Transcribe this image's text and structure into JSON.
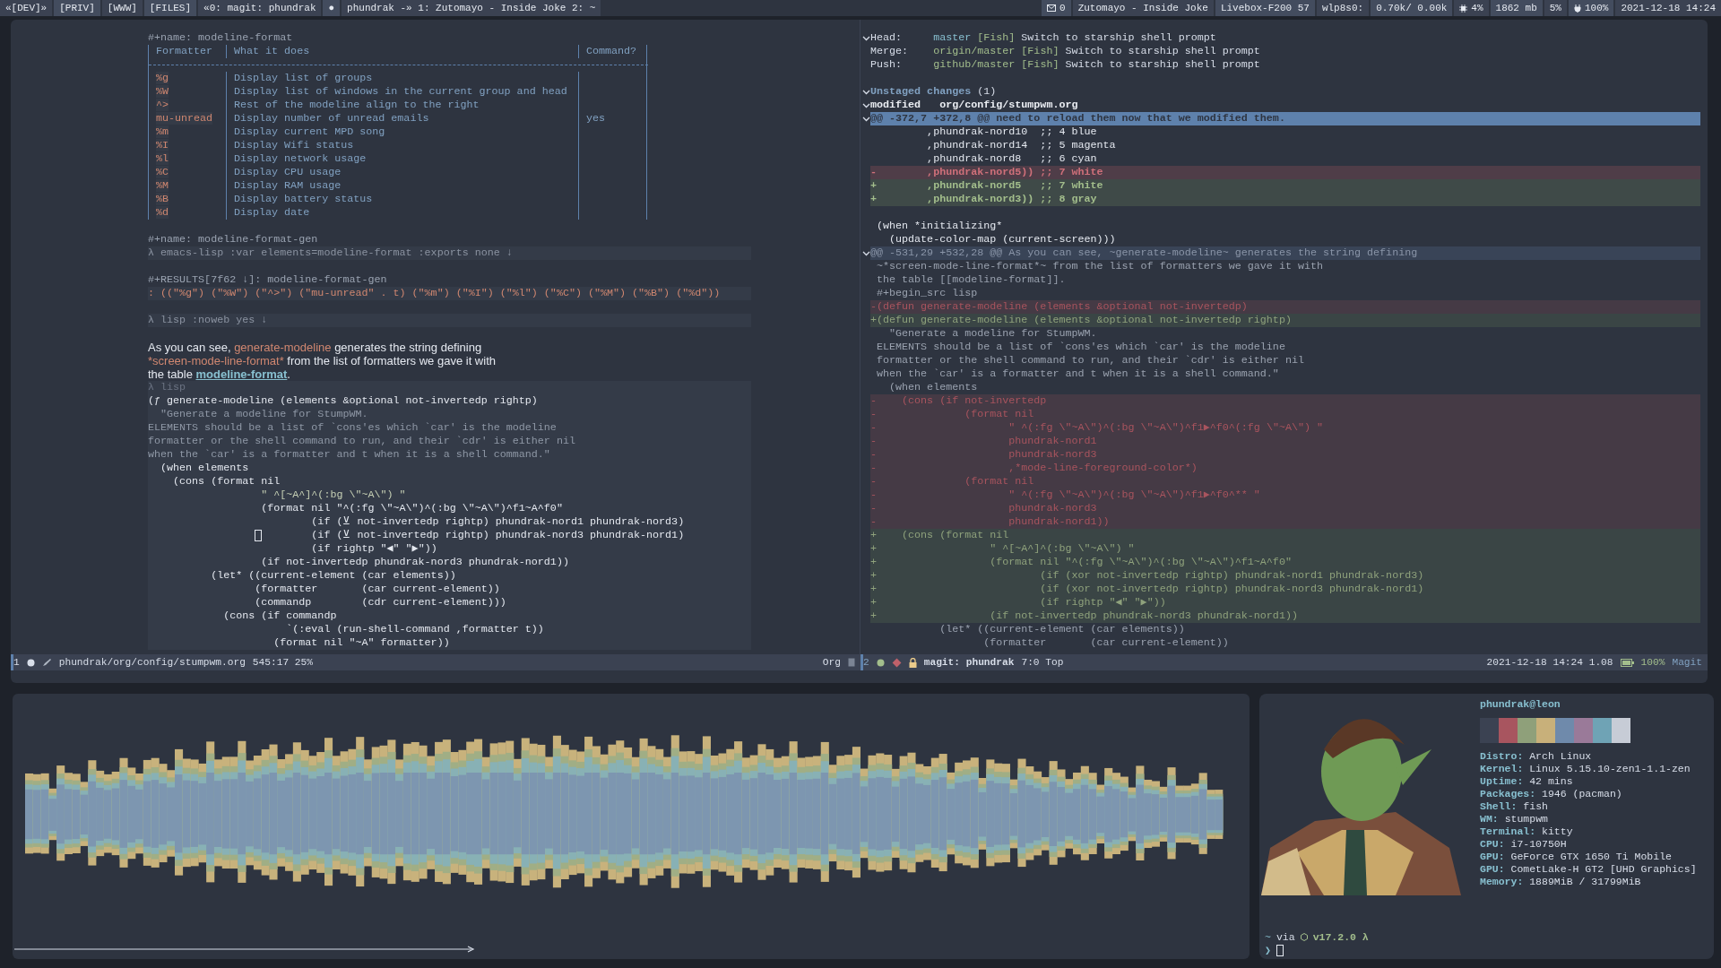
{
  "top_bar": {
    "left": [
      "«[DEV]»",
      "[PRIV]",
      "[WWW]",
      "[FILES]",
      "«0: magit: phundrak",
      "●",
      "phundrak -» 1: Zutomayo - Inside Joke 2: ~"
    ],
    "right": [
      {
        "kind": "mail",
        "text": "0"
      },
      {
        "kind": "plain",
        "text": "Zutomayo - Inside Joke"
      },
      {
        "kind": "plain",
        "text": "Livebox-F200 57"
      },
      {
        "kind": "plain",
        "text": "wlp8s0:"
      },
      {
        "kind": "plain",
        "text": "0.70k/ 0.00k"
      },
      {
        "kind": "cpu",
        "text": "4%"
      },
      {
        "kind": "plain",
        "text": "1862 mb"
      },
      {
        "kind": "plain",
        "text": "5%"
      },
      {
        "kind": "power",
        "text": "100%"
      },
      {
        "kind": "plain",
        "text": "2021-12-18 14:24"
      }
    ]
  },
  "left_pane": [
    {
      "kind": "keyword",
      "text": "#+name: modeline-format"
    },
    {
      "kind": "table",
      "columns": [
        "Formatter",
        "What it does",
        "Command?"
      ],
      "rows": [
        [
          "%g",
          "Display list of groups",
          ""
        ],
        [
          "%W",
          "Display list of windows in the current group and head",
          ""
        ],
        [
          "^>",
          "Rest of the modeline align to the right",
          ""
        ],
        [
          "mu-unread",
          "Display number of unread emails",
          "yes"
        ],
        [
          "%m",
          "Display current MPD song",
          ""
        ],
        [
          "%I",
          "Display Wifi status",
          ""
        ],
        [
          "%l",
          "Display network usage",
          ""
        ],
        [
          "%C",
          "Display CPU usage",
          ""
        ],
        [
          "%M",
          "Display RAM usage",
          ""
        ],
        [
          "%B",
          "Display battery status",
          ""
        ],
        [
          "%d",
          "Display date",
          ""
        ]
      ]
    },
    {
      "kind": "spacer"
    },
    {
      "kind": "keyword",
      "text": "#+name: modeline-format-gen"
    },
    {
      "kind": "src-header",
      "text": "λ emacs-lisp :var elements=modeline-format :exports none ↓"
    },
    {
      "kind": "spacer"
    },
    {
      "kind": "keyword",
      "text": "#+RESULTS[7f62 ↓]: modeline-format-gen"
    },
    {
      "kind": "result",
      "text": ": ((\"%g\") (\"%W\") (\"^>\") (\"mu-unread\" . t) (\"%m\") (\"%I\") (\"%l\") (\"%C\") (\"%M\") (\"%B\") (\"%d\"))"
    },
    {
      "kind": "spacer"
    },
    {
      "kind": "src-header",
      "text": "λ lisp :noweb yes ↓"
    },
    {
      "kind": "spacer"
    },
    {
      "kind": "prose",
      "lines": [
        [
          {
            "kind": "plain",
            "text": "As you can see, "
          },
          {
            "kind": "code",
            "text": "generate-modeline"
          },
          {
            "kind": "plain",
            "text": " generates the string defining"
          }
        ],
        [
          {
            "kind": "code",
            "text": "*screen-mode-line-format*"
          },
          {
            "kind": "plain",
            "text": " from the list of formatters we gave it with"
          }
        ],
        [
          {
            "kind": "plain",
            "text": "the table "
          },
          {
            "kind": "link",
            "text": "modeline-format"
          },
          {
            "kind": "plain",
            "text": "."
          }
        ]
      ]
    },
    {
      "kind": "src-block",
      "header": "λ lisp",
      "lines": [
        {
          "kind": "code",
          "text": "(ƒ generate-modeline (elements &optional not-invertedp rightp)"
        },
        {
          "kind": "doc",
          "text": "  \"Generate a modeline for StumpWM."
        },
        {
          "kind": "doc",
          "text": "ELEMENTS should be a list of `cons'es which `car' is the modeline"
        },
        {
          "kind": "doc",
          "text": "formatter or the shell command to run, and their `cdr' is either nil"
        },
        {
          "kind": "doc",
          "text": "when the `car' is a formatter and t when it is a shell command.\""
        },
        {
          "kind": "code",
          "text": "  (when elements"
        },
        {
          "kind": "code",
          "text": "    (cons (format nil"
        },
        {
          "kind": "string",
          "text": "                  \" ^[~A^]^(:bg \\\"~A\\\") \""
        },
        {
          "kind": "code",
          "text": "                  (format nil \"^(:fg \\\"~A\\\")^(:bg \\\"~A\\\")^f1~A^f0\""
        },
        {
          "kind": "code",
          "text": "                          (if (⊻ not-invertedp rightp) phundrak-nord1 phundrak-nord3)"
        },
        {
          "kind": "code",
          "text": "                          (if (⊻ not-invertedp rightp) phundrak-nord3 phundrak-nord1)",
          "cursor": true
        },
        {
          "kind": "code",
          "text": "                          (if rightp \"◀\" \"▶\"))"
        },
        {
          "kind": "code",
          "text": "                  (if not-invertedp phundrak-nord3 phundrak-nord1))"
        },
        {
          "kind": "code",
          "text": "          (let* ((current-element (car elements))"
        },
        {
          "kind": "code",
          "text": "                 (formatter       (car current-element))"
        },
        {
          "kind": "code",
          "text": "                 (commandp        (cdr current-element)))"
        },
        {
          "kind": "code",
          "text": "            (cons (if commandp"
        },
        {
          "kind": "code",
          "text": "                      `(:eval (run-shell-command ,formatter t))"
        },
        {
          "kind": "code",
          "text": "                    (format nil \"~A\" formatter))"
        }
      ]
    }
  ],
  "left_modeline": {
    "window": "1",
    "path": "phundrak/org/config/stumpwm.org",
    "position": "545:17 25%",
    "mode": "Org"
  },
  "right_pane": {
    "refs": [
      {
        "label": "Head:",
        "ref": "master",
        "tag": "[Fish]",
        "message": "Switch to starship shell prompt"
      },
      {
        "label": "Merge:",
        "ref": "origin/master",
        "tag": "[Fish]",
        "message": "Switch to starship shell prompt"
      },
      {
        "label": "Push:",
        "ref": "github/master",
        "tag": "[Fish]",
        "message": "Switch to starship shell prompt"
      }
    ],
    "section": {
      "title": "Unstaged changes",
      "count": "(1)"
    },
    "file": {
      "status": "modified",
      "path": "org/config/stumpwm.org"
    },
    "hunks": [
      {
        "header": "@@ -372,7 +372,8 @@ need to reload them now that we modified them.",
        "current": true,
        "lines": [
          {
            "kind": "context",
            "text": "         ,phundrak-nord10  ;; 4 blue"
          },
          {
            "kind": "context",
            "text": "         ,phundrak-nord14  ;; 5 magenta"
          },
          {
            "kind": "context",
            "text": "         ,phundrak-nord8   ;; 6 cyan"
          },
          {
            "kind": "removed",
            "text": "-        ,phundrak-nord5)) ;; 7 white"
          },
          {
            "kind": "added",
            "text": "+        ,phundrak-nord5   ;; 7 white"
          },
          {
            "kind": "added",
            "text": "+        ,phundrak-nord3)) ;; 8 gray"
          },
          {
            "kind": "spacer"
          },
          {
            "kind": "context",
            "text": " (when *initializing*"
          },
          {
            "kind": "context",
            "text": "   (update-color-map (current-screen)))"
          }
        ]
      },
      {
        "header": "@@ -531,29 +532,28 @@ As you can see, ~generate-modeline~ generates the string defining",
        "current": false,
        "lines": [
          {
            "kind": "context",
            "text": " ~*screen-mode-line-format*~ from the list of formatters we gave it with"
          },
          {
            "kind": "context",
            "text": " the table [[modeline-format]]."
          },
          {
            "kind": "context",
            "text": " #+begin_src lisp"
          },
          {
            "kind": "removed",
            "text": "-(defun generate-modeline (elements &optional not-invertedp)"
          },
          {
            "kind": "added",
            "text": "+(defun generate-modeline (elements &optional not-invertedp rightp)"
          },
          {
            "kind": "context",
            "text": "   \"Generate a modeline for StumpWM."
          },
          {
            "kind": "context",
            "text": " ELEMENTS should be a list of `cons'es which `car' is the modeline"
          },
          {
            "kind": "context",
            "text": " formatter or the shell command to run, and their `cdr' is either nil"
          },
          {
            "kind": "context",
            "text": " when the `car' is a formatter and t when it is a shell command.\""
          },
          {
            "kind": "context",
            "text": "   (when elements"
          },
          {
            "kind": "removed",
            "text": "-    (cons (if not-invertedp"
          },
          {
            "kind": "removed",
            "text": "-              (format nil"
          },
          {
            "kind": "removed",
            "text": "-                     \" ^(:fg \\\"~A\\\")^(:bg \\\"~A\\\")^f1▶^f0^(:fg \\\"~A\\\") \""
          },
          {
            "kind": "removed",
            "text": "-                     phundrak-nord1"
          },
          {
            "kind": "removed",
            "text": "-                     phundrak-nord3"
          },
          {
            "kind": "removed",
            "text": "-                     ,*mode-line-foreground-color*)"
          },
          {
            "kind": "removed",
            "text": "-              (format nil"
          },
          {
            "kind": "removed",
            "text": "-                     \" ^(:fg \\\"~A\\\")^(:bg \\\"~A\\\")^f1▶^f0^** \""
          },
          {
            "kind": "removed",
            "text": "-                     phundrak-nord3"
          },
          {
            "kind": "removed",
            "text": "-                     phundrak-nord1))"
          },
          {
            "kind": "added",
            "text": "+    (cons (format nil"
          },
          {
            "kind": "added",
            "text": "+                  \" ^[~A^]^(:bg \\\"~A\\\") \""
          },
          {
            "kind": "added",
            "text": "+                  (format nil \"^(:fg \\\"~A\\\")^(:bg \\\"~A\\\")^f1~A^f0\""
          },
          {
            "kind": "added",
            "text": "+                          (if (xor not-invertedp rightp) phundrak-nord1 phundrak-nord3)"
          },
          {
            "kind": "added",
            "text": "+                          (if (xor not-invertedp rightp) phundrak-nord3 phundrak-nord1)"
          },
          {
            "kind": "added",
            "text": "+                          (if rightp \"◀\" \"▶\"))"
          },
          {
            "kind": "added",
            "text": "+                  (if not-invertedp phundrak-nord3 phundrak-nord1))"
          },
          {
            "kind": "context",
            "text": "           (let* ((current-element (car elements))"
          },
          {
            "kind": "context",
            "text": "                  (formatter       (car current-element))"
          }
        ]
      }
    ]
  },
  "right_modeline": {
    "window": "2",
    "buffer": "magit: phundrak",
    "position": "7:0 Top",
    "datetime": "2021-12-18 14:24 1.08",
    "battery": "100%",
    "mode": "Magit"
  },
  "terminal": {
    "user_host": "phundrak@leon",
    "palette": [
      {
        "color": "#3b4252"
      },
      {
        "color": "#a8555f"
      },
      {
        "color": "#8fa07a"
      },
      {
        "color": "#c8b07a"
      },
      {
        "color": "#6f8aab"
      },
      {
        "color": "#9a7a99"
      },
      {
        "color": "#6fa3b5"
      },
      {
        "color": "#c7ccd6"
      }
    ],
    "info": [
      {
        "label": "Distro:",
        "value": "Arch Linux"
      },
      {
        "label": "Kernel:",
        "value": "Linux 5.15.10-zen1-1.1-zen"
      },
      {
        "label": "Uptime:",
        "value": "42 mins"
      },
      {
        "label": "Packages:",
        "value": "1946 (pacman)"
      },
      {
        "label": "Shell:",
        "value": "fish"
      },
      {
        "label": "WM:",
        "value": "stumpwm"
      },
      {
        "label": "Terminal:",
        "value": "kitty"
      },
      {
        "label": "CPU:",
        "value": "i7-10750H"
      },
      {
        "label": "GPU:",
        "value": "GeForce GTX 1650 Ti Mobile"
      },
      {
        "label": "GPU:",
        "value": "CometLake-H GT2 [UHD Graphics]"
      },
      {
        "label": "Memory:",
        "value": "1889MiB / 31799MiB"
      }
    ],
    "prompt": {
      "dir": "~",
      "via": "via",
      "version": "v17.2.0 λ",
      "symbol": "❯"
    }
  }
}
